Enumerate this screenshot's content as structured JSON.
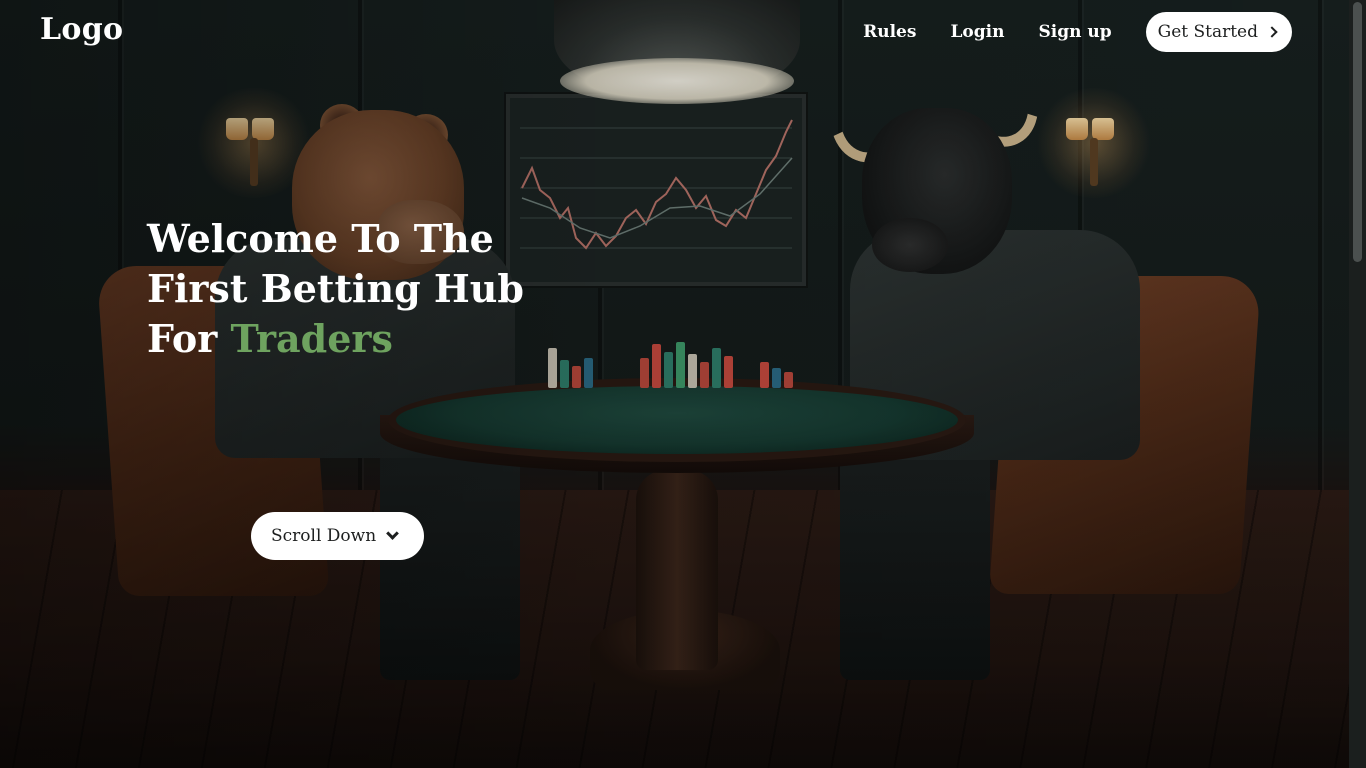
{
  "header": {
    "logo": "Logo",
    "nav": [
      {
        "label": "Rules"
      },
      {
        "label": "Login"
      },
      {
        "label": "Sign up"
      }
    ],
    "cta_label": "Get Started",
    "cta_icon": "chevron-right-icon"
  },
  "hero": {
    "title_line1": "Welcome To The",
    "title_line2": "First Betting Hub",
    "title_line3_prefix": "For",
    "title_accent": "Traders",
    "accent_color": "#6ea35f",
    "background_image": "bear-and-bull-poker-table",
    "scroll_label": "Scroll Down",
    "scroll_icon": "chevron-down-icon"
  }
}
